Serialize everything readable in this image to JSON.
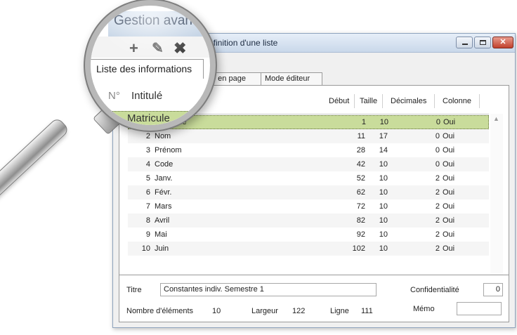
{
  "window": {
    "title": "éfinition d'une liste",
    "controls": {
      "minimize": "minimize",
      "maximize": "maximize",
      "close": "✕"
    }
  },
  "tabs": [
    {
      "label": ""
    },
    {
      "label": "e en page"
    },
    {
      "label": "Mode éditeur"
    }
  ],
  "grid": {
    "headers": {
      "num": "N°",
      "intitule": "Intitulé",
      "debut": "Début",
      "taille": "Taille",
      "decimales": "Décimales",
      "colonne": "Colonne"
    },
    "rows": [
      {
        "num": "1",
        "intitule": "Matricule",
        "debut": "1",
        "taille": "10",
        "decimales": "0",
        "colonne": "Oui",
        "selected": true
      },
      {
        "num": "2",
        "intitule": "Nom",
        "debut": "11",
        "taille": "17",
        "decimales": "0",
        "colonne": "Oui"
      },
      {
        "num": "3",
        "intitule": "Prénom",
        "debut": "28",
        "taille": "14",
        "decimales": "0",
        "colonne": "Oui"
      },
      {
        "num": "4",
        "intitule": "Code",
        "debut": "42",
        "taille": "10",
        "decimales": "0",
        "colonne": "Oui"
      },
      {
        "num": "5",
        "intitule": "Janv.",
        "debut": "52",
        "taille": "10",
        "decimales": "2",
        "colonne": "Oui"
      },
      {
        "num": "6",
        "intitule": "Févr.",
        "debut": "62",
        "taille": "10",
        "decimales": "2",
        "colonne": "Oui"
      },
      {
        "num": "7",
        "intitule": "Mars",
        "debut": "72",
        "taille": "10",
        "decimales": "2",
        "colonne": "Oui"
      },
      {
        "num": "8",
        "intitule": "Avril",
        "debut": "82",
        "taille": "10",
        "decimales": "2",
        "colonne": "Oui"
      },
      {
        "num": "9",
        "intitule": "Mai",
        "debut": "92",
        "taille": "10",
        "decimales": "2",
        "colonne": "Oui"
      },
      {
        "num": "10",
        "intitule": "Juin",
        "debut": "102",
        "taille": "10",
        "decimales": "2",
        "colonne": "Oui"
      }
    ]
  },
  "form": {
    "titre_label": "Titre",
    "titre_value": "Constantes indiv. Semestre 1",
    "confidentialite_label": "Confidentialité",
    "confidentialite_value": "0",
    "nombre_label": "Nombre d'éléments",
    "nombre_value": "10",
    "largeur_label": "Largeur",
    "largeur_value": "122",
    "ligne_label": "Ligne",
    "ligne_value": "111",
    "memo_label": "Mémo",
    "memo_value": ""
  },
  "magnifier": {
    "title": "Gestion avan",
    "tab_label": "Liste des informations",
    "header_num": "N°",
    "header_intitule": "Intitulé",
    "row_text": "Matricule",
    "tools": {
      "add": "+",
      "edit": "✎",
      "delete": "✖"
    }
  },
  "colors": {
    "selected_row": "#c9dc9b",
    "titlebar": "#c9d8ea",
    "close_button": "#c1402b"
  }
}
